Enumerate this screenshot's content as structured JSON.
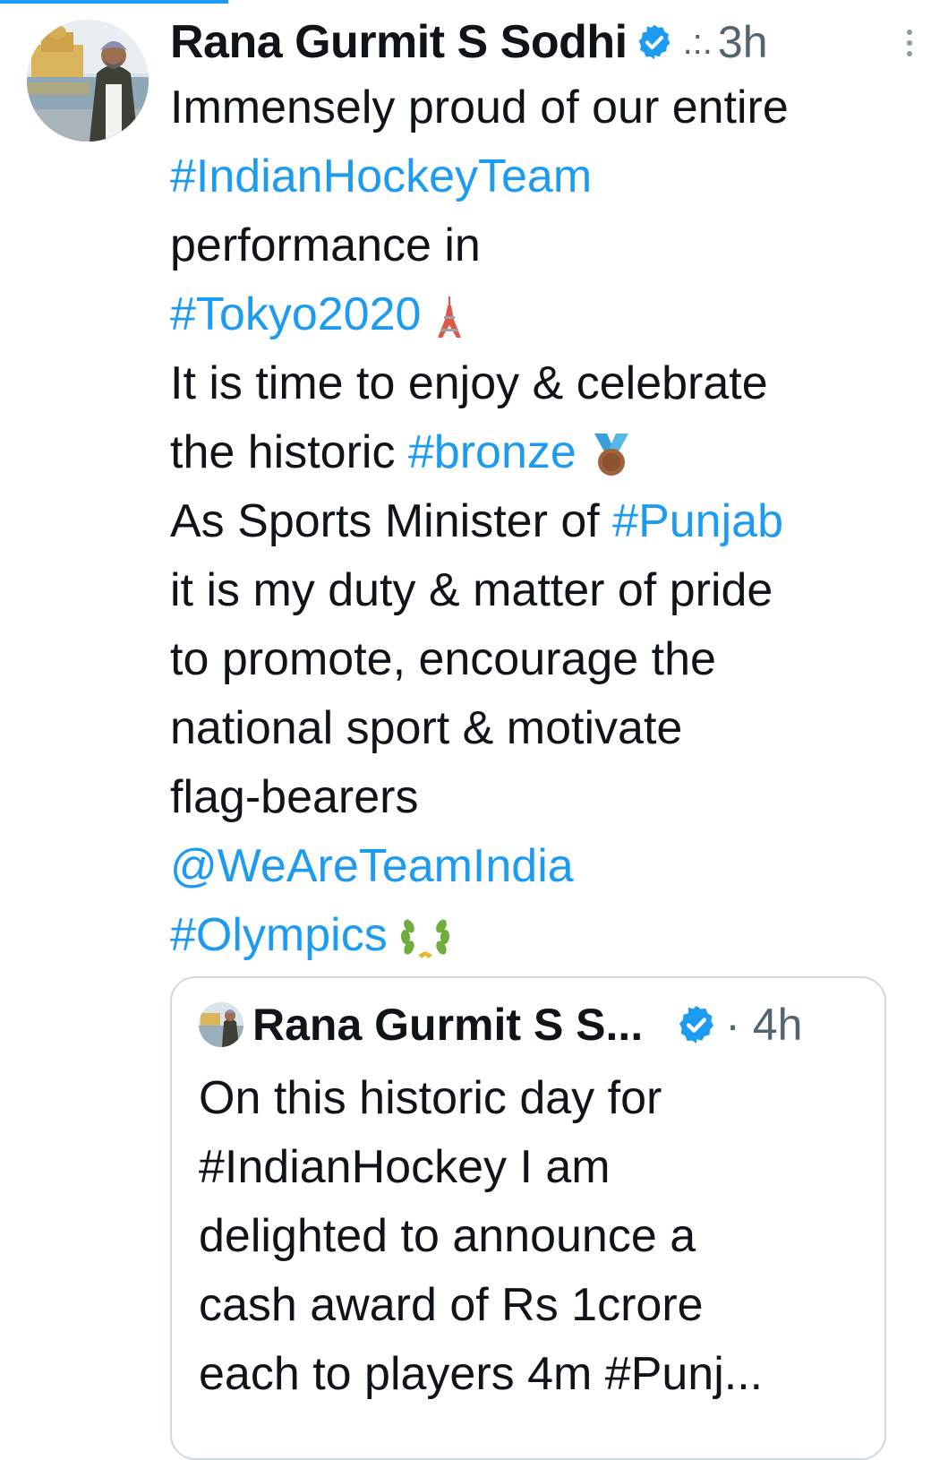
{
  "tweet": {
    "author_name": "Rana Gurmit S Sodhi",
    "time_separator": ".:.",
    "time": "3h",
    "body_lines": [
      {
        "parts": [
          {
            "text": "Immensely proud of our entire",
            "link": false
          }
        ]
      },
      {
        "parts": [
          {
            "text": "#IndianHockeyTeam",
            "link": true
          }
        ]
      },
      {
        "parts": [
          {
            "text": "performance in",
            "link": false
          }
        ]
      },
      {
        "parts": [
          {
            "text": "#Tokyo2020",
            "link": true
          }
        ],
        "emoji": "tokyo-tower-icon"
      },
      {
        "parts": [
          {
            "text": "It is time to enjoy & celebrate",
            "link": false
          }
        ]
      },
      {
        "parts": [
          {
            "text": "the historic ",
            "link": false
          },
          {
            "text": "#bronze",
            "link": true
          }
        ],
        "emoji": "bronze-medal-icon"
      },
      {
        "parts": [
          {
            "text": "As Sports Minister of ",
            "link": false
          },
          {
            "text": "#Punjab",
            "link": true
          }
        ]
      },
      {
        "parts": [
          {
            "text": "it is my duty & matter of pride",
            "link": false
          }
        ]
      },
      {
        "parts": [
          {
            "text": "to promote, encourage the",
            "link": false
          }
        ]
      },
      {
        "parts": [
          {
            "text": "national sport & motivate",
            "link": false
          }
        ]
      },
      {
        "parts": [
          {
            "text": "flag-bearers",
            "link": false
          }
        ]
      },
      {
        "parts": [
          {
            "text": "@WeAreTeamIndia",
            "link": true
          }
        ]
      },
      {
        "parts": [
          {
            "text": "#Olympics",
            "link": true
          }
        ],
        "emoji": "olympic-laurel-icon"
      }
    ]
  },
  "quoted_tweet": {
    "author_name": "Rana Gurmit S S...",
    "time": "· 4h",
    "body_lines": [
      "On this historic day for",
      "#IndianHockey I am",
      "delighted to announce a",
      "cash award of Rs 1crore",
      "each to players 4m #Punj..."
    ]
  },
  "colors": {
    "link": "#1d9bf0",
    "verified": "#1d9bf0",
    "secondary_text": "#536471",
    "border": "#cfd9de"
  }
}
